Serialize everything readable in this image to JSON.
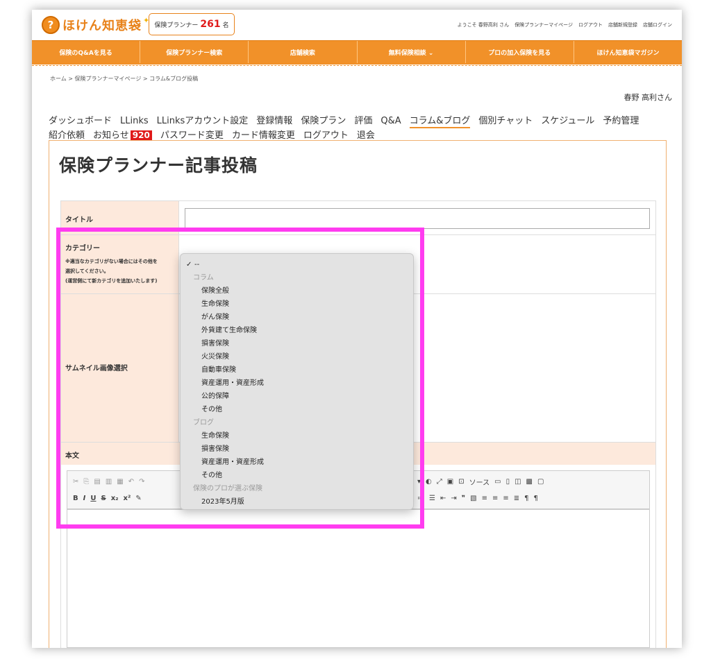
{
  "header": {
    "logo_text": "ほけん知恵袋",
    "planner_label": "保険プランナー",
    "planner_count": "261",
    "planner_unit": "名",
    "links": [
      "ようこそ 春野高利 さん",
      "保険プランナーマイページ",
      "ログアウト",
      "店舗新規登録",
      "店舗ログイン"
    ]
  },
  "nav": [
    "保険のQ&Aを見る",
    "保険プランナー検索",
    "店舗検索",
    "無料保険相談 ⌄",
    "プロの加入保険を見る",
    "ほけん知恵袋マガジン"
  ],
  "breadcrumb": "ホーム > 保険プランナーマイページ > コラム&ブログ投稿",
  "user_name": "春野 高利さん",
  "tabs": [
    "ダッシュボード",
    "LLinks",
    "LLinksアカウント設定",
    "登録情報",
    "保険プラン",
    "評価",
    "Q&A",
    "コラム&ブログ",
    "個別チャット",
    "スケジュール",
    "予約管理",
    "紹介依頼",
    "お知らせ",
    "パスワード変更",
    "カード情報変更",
    "ログアウト",
    "退会"
  ],
  "notification_count": "920",
  "page_title": "保険プランナー記事投稿",
  "form": {
    "title_label": "タイトル",
    "category_label": "カテゴリー",
    "category_note": [
      "※適当なカテゴリがない場合にはその他を",
      "選択してください。",
      "(運営側にて新カテゴリを追加いたします)"
    ],
    "thumbnail_label": "サムネイル画像選択",
    "body_label": "本文",
    "source_button": "ソース"
  },
  "dropdown": {
    "selected": "--",
    "groups": [
      {
        "label": "コラム",
        "options": [
          "保険全般",
          "生命保険",
          "がん保険",
          "外貨建て生命保険",
          "損害保険",
          "火災保険",
          "自動車保険",
          "資産運用・資産形成",
          "公的保障",
          "その他"
        ]
      },
      {
        "label": "ブログ",
        "options": [
          "生命保険",
          "損害保険",
          "資産運用・資産形成",
          "その他"
        ]
      },
      {
        "label": "保険のプロが選ぶ保険",
        "options": [
          "2023年5月版"
        ]
      }
    ]
  },
  "colors": {
    "brand_orange": "#f19129",
    "highlight": "#ff3cf0",
    "label_bg": "#fde9dc",
    "badge_red": "#e01a1a"
  }
}
